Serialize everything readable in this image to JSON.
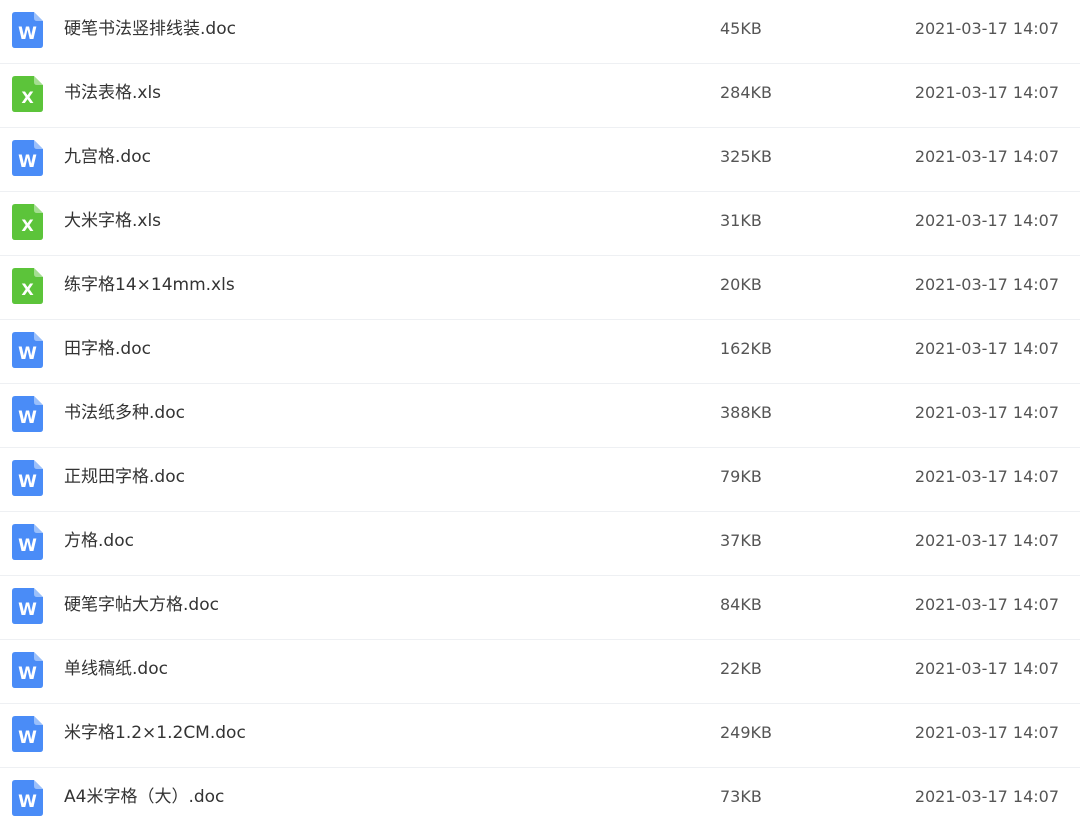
{
  "colors": {
    "word_icon": "#4a8cf7",
    "excel_icon": "#5cc43a",
    "icon_letter": "#ffffff",
    "divider": "#eef0f3"
  },
  "files": [
    {
      "name": "硬笔书法竖排线装.doc",
      "size": "45KB",
      "date": "2021-03-17 14:07",
      "type": "word",
      "icon": "word-file-icon",
      "letter": "W"
    },
    {
      "name": "书法表格.xls",
      "size": "284KB",
      "date": "2021-03-17 14:07",
      "type": "excel",
      "icon": "excel-file-icon",
      "letter": "X"
    },
    {
      "name": "九宫格.doc",
      "size": "325KB",
      "date": "2021-03-17 14:07",
      "type": "word",
      "icon": "word-file-icon",
      "letter": "W"
    },
    {
      "name": "大米字格.xls",
      "size": "31KB",
      "date": "2021-03-17 14:07",
      "type": "excel",
      "icon": "excel-file-icon",
      "letter": "X"
    },
    {
      "name": "练字格14×14mm.xls",
      "size": "20KB",
      "date": "2021-03-17 14:07",
      "type": "excel",
      "icon": "excel-file-icon",
      "letter": "X"
    },
    {
      "name": "田字格.doc",
      "size": "162KB",
      "date": "2021-03-17 14:07",
      "type": "word",
      "icon": "word-file-icon",
      "letter": "W"
    },
    {
      "name": "书法纸多种.doc",
      "size": "388KB",
      "date": "2021-03-17 14:07",
      "type": "word",
      "icon": "word-file-icon",
      "letter": "W"
    },
    {
      "name": "正规田字格.doc",
      "size": "79KB",
      "date": "2021-03-17 14:07",
      "type": "word",
      "icon": "word-file-icon",
      "letter": "W"
    },
    {
      "name": "方格.doc",
      "size": "37KB",
      "date": "2021-03-17 14:07",
      "type": "word",
      "icon": "word-file-icon",
      "letter": "W"
    },
    {
      "name": "硬笔字帖大方格.doc",
      "size": "84KB",
      "date": "2021-03-17 14:07",
      "type": "word",
      "icon": "word-file-icon",
      "letter": "W"
    },
    {
      "name": "单线稿纸.doc",
      "size": "22KB",
      "date": "2021-03-17 14:07",
      "type": "word",
      "icon": "word-file-icon",
      "letter": "W"
    },
    {
      "name": "米字格1.2×1.2CM.doc",
      "size": "249KB",
      "date": "2021-03-17 14:07",
      "type": "word",
      "icon": "word-file-icon",
      "letter": "W"
    },
    {
      "name": "A4米字格（大）.doc",
      "size": "73KB",
      "date": "2021-03-17 14:07",
      "type": "word",
      "icon": "word-file-icon",
      "letter": "W"
    }
  ]
}
